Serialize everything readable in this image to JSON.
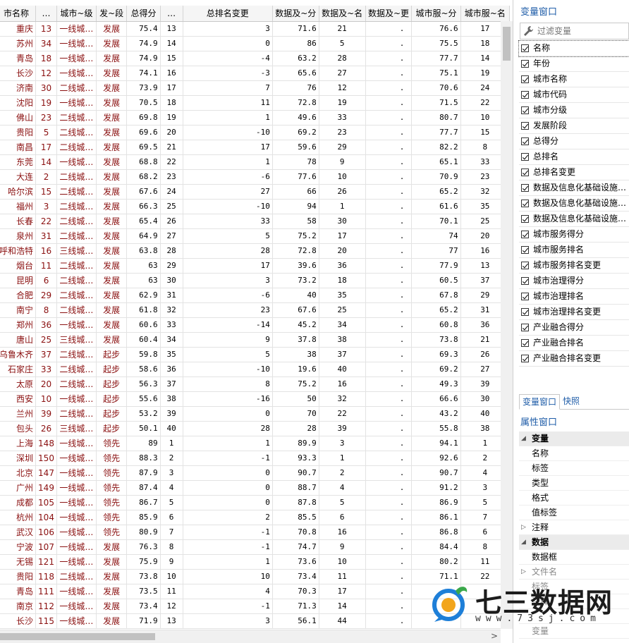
{
  "grid": {
    "columns": [
      "市名称",
      "…",
      "城市~级",
      "发~段",
      "总得分",
      "…",
      "总排名变更",
      "数据及~分",
      "数据及~名",
      "数据及~更",
      "城市服~分",
      "城市服~名"
    ],
    "rows": [
      [
        "重庆",
        "13",
        "一线城…",
        "发展",
        "75.4",
        "13",
        "3",
        "71.6",
        "21",
        ".",
        "76.6",
        "17"
      ],
      [
        "苏州",
        "34",
        "一线城…",
        "发展",
        "74.9",
        "14",
        "0",
        "86",
        "5",
        ".",
        "75.5",
        "18"
      ],
      [
        "青岛",
        "18",
        "一线城…",
        "发展",
        "74.9",
        "15",
        "-4",
        "63.2",
        "28",
        ".",
        "77.7",
        "14"
      ],
      [
        "长沙",
        "12",
        "一线城…",
        "发展",
        "74.1",
        "16",
        "-3",
        "65.6",
        "27",
        ".",
        "75.1",
        "19"
      ],
      [
        "济南",
        "30",
        "二线城…",
        "发展",
        "73.9",
        "17",
        "7",
        "76",
        "12",
        ".",
        "70.6",
        "24"
      ],
      [
        "沈阳",
        "19",
        "一线城…",
        "发展",
        "70.5",
        "18",
        "11",
        "72.8",
        "19",
        ".",
        "71.5",
        "22"
      ],
      [
        "佛山",
        "23",
        "二线城…",
        "发展",
        "69.8",
        "19",
        "1",
        "49.6",
        "33",
        ".",
        "80.7",
        "10"
      ],
      [
        "贵阳",
        "5",
        "二线城…",
        "发展",
        "69.6",
        "20",
        "-10",
        "69.2",
        "23",
        ".",
        "77.7",
        "15"
      ],
      [
        "南昌",
        "17",
        "二线城…",
        "发展",
        "69.5",
        "21",
        "17",
        "59.6",
        "29",
        ".",
        "82.2",
        "8"
      ],
      [
        "东莞",
        "14",
        "一线城…",
        "发展",
        "68.8",
        "22",
        "1",
        "78",
        "9",
        ".",
        "65.1",
        "33"
      ],
      [
        "大连",
        "2",
        "二线城…",
        "发展",
        "68.2",
        "23",
        "-6",
        "77.6",
        "10",
        ".",
        "70.9",
        "23"
      ],
      [
        "哈尔滨",
        "15",
        "二线城…",
        "发展",
        "67.6",
        "24",
        "27",
        "66",
        "26",
        ".",
        "65.2",
        "32"
      ],
      [
        "福州",
        "3",
        "二线城…",
        "发展",
        "66.3",
        "25",
        "-10",
        "94",
        "1",
        ".",
        "61.6",
        "35"
      ],
      [
        "长春",
        "22",
        "二线城…",
        "发展",
        "65.4",
        "26",
        "33",
        "58",
        "30",
        ".",
        "70.1",
        "25"
      ],
      [
        "泉州",
        "31",
        "二线城…",
        "发展",
        "64.9",
        "27",
        "5",
        "75.2",
        "17",
        ".",
        "74",
        "20"
      ],
      [
        "呼和浩特",
        "16",
        "三线城…",
        "发展",
        "63.8",
        "28",
        "28",
        "72.8",
        "20",
        ".",
        "77",
        "16"
      ],
      [
        "烟台",
        "11",
        "二线城…",
        "发展",
        "63",
        "29",
        "17",
        "39.6",
        "36",
        ".",
        "77.9",
        "13"
      ],
      [
        "昆明",
        "6",
        "二线城…",
        "发展",
        "63",
        "30",
        "3",
        "73.2",
        "18",
        ".",
        "60.5",
        "37"
      ],
      [
        "合肥",
        "29",
        "二线城…",
        "发展",
        "62.9",
        "31",
        "-6",
        "40",
        "35",
        ".",
        "67.8",
        "29"
      ],
      [
        "南宁",
        "8",
        "二线城…",
        "发展",
        "61.8",
        "32",
        "23",
        "67.6",
        "25",
        ".",
        "65.2",
        "31"
      ],
      [
        "郑州",
        "36",
        "一线城…",
        "发展",
        "60.6",
        "33",
        "-14",
        "45.2",
        "34",
        ".",
        "60.8",
        "36"
      ],
      [
        "唐山",
        "25",
        "三线城…",
        "发展",
        "60.4",
        "34",
        "9",
        "37.8",
        "38",
        ".",
        "73.8",
        "21"
      ],
      [
        "乌鲁木齐",
        "37",
        "二线城…",
        "起步",
        "59.8",
        "35",
        "5",
        "38",
        "37",
        ".",
        "69.3",
        "26"
      ],
      [
        "石家庄",
        "33",
        "二线城…",
        "起步",
        "58.6",
        "36",
        "-10",
        "19.6",
        "40",
        ".",
        "69.2",
        "27"
      ],
      [
        "太原",
        "20",
        "二线城…",
        "起步",
        "56.3",
        "37",
        "8",
        "75.2",
        "16",
        ".",
        "49.3",
        "39"
      ],
      [
        "西安",
        "10",
        "一线城…",
        "起步",
        "55.6",
        "38",
        "-16",
        "50",
        "32",
        ".",
        "66.6",
        "30"
      ],
      [
        "兰州",
        "39",
        "二线城…",
        "起步",
        "53.2",
        "39",
        "0",
        "70",
        "22",
        ".",
        "43.2",
        "40"
      ],
      [
        "包头",
        "26",
        "三线城…",
        "起步",
        "50.1",
        "40",
        "28",
        "28",
        "39",
        ".",
        "55.8",
        "38"
      ],
      [
        "上海",
        "148",
        "一线城…",
        "领先",
        "89",
        "1",
        "1",
        "89.9",
        "3",
        ".",
        "94.1",
        "1"
      ],
      [
        "深圳",
        "150",
        "一线城…",
        "领先",
        "88.3",
        "2",
        "-1",
        "93.3",
        "1",
        ".",
        "92.6",
        "2"
      ],
      [
        "北京",
        "147",
        "一线城…",
        "领先",
        "87.9",
        "3",
        "0",
        "90.7",
        "2",
        ".",
        "90.7",
        "4"
      ],
      [
        "广州",
        "149",
        "一线城…",
        "领先",
        "87.4",
        "4",
        "0",
        "88.7",
        "4",
        ".",
        "91.2",
        "3"
      ],
      [
        "成都",
        "105",
        "一线城…",
        "领先",
        "86.7",
        "5",
        "0",
        "87.8",
        "5",
        ".",
        "86.9",
        "5"
      ],
      [
        "杭州",
        "104",
        "一线城…",
        "领先",
        "85.9",
        "6",
        "2",
        "85.5",
        "6",
        ".",
        "86.1",
        "7"
      ],
      [
        "武汉",
        "106",
        "一线城…",
        "领先",
        "80.9",
        "7",
        "-1",
        "70.8",
        "16",
        ".",
        "86.8",
        "6"
      ],
      [
        "宁波",
        "107",
        "一线城…",
        "发展",
        "76.3",
        "8",
        "-1",
        "74.7",
        "9",
        ".",
        "84.4",
        "8"
      ],
      [
        "无锡",
        "121",
        "一线城…",
        "发展",
        "75.9",
        "9",
        "1",
        "73.6",
        "10",
        ".",
        "80.2",
        "11"
      ],
      [
        "贵阳",
        "118",
        "二线城…",
        "发展",
        "73.8",
        "10",
        "10",
        "73.4",
        "11",
        ".",
        "71.1",
        "22"
      ],
      [
        "青岛",
        "111",
        "一线城…",
        "发展",
        "73.5",
        "11",
        "4",
        "70.3",
        "17",
        ".",
        "",
        ""
      ],
      [
        "南京",
        "112",
        "一线城…",
        "发展",
        "73.4",
        "12",
        "-1",
        "71.3",
        "14",
        ".",
        "",
        ""
      ],
      [
        "长沙",
        "115",
        "一线城…",
        "发展",
        "71.9",
        "13",
        "3",
        "56.1",
        "44",
        ".",
        "",
        ""
      ]
    ]
  },
  "panel": {
    "var_title": "变量窗口",
    "filter_placeholder": "过滤变量",
    "variables": [
      "名称",
      "年份",
      "城市名称",
      "城市代码",
      "城市分级",
      "发展阶段",
      "总得分",
      "总排名",
      "总排名变更",
      "数据及信息化基础设施…",
      "数据及信息化基础设施…",
      "数据及信息化基础设施…",
      "城市服务得分",
      "城市服务排名",
      "城市服务排名变更",
      "城市治理得分",
      "城市治理排名",
      "城市治理排名变更",
      "产业融合得分",
      "产业融合排名",
      "产业融合排名变更"
    ],
    "tabs": [
      "变量窗口",
      "快照"
    ],
    "prop_title": "属性窗口",
    "props": [
      {
        "label": "变量",
        "kind": "group"
      },
      {
        "label": "名称",
        "kind": "child"
      },
      {
        "label": "标签",
        "kind": "child"
      },
      {
        "label": "类型",
        "kind": "child"
      },
      {
        "label": "格式",
        "kind": "child"
      },
      {
        "label": "值标签",
        "kind": "child"
      },
      {
        "label": "注释",
        "kind": "collapsed"
      },
      {
        "label": "数据",
        "kind": "group"
      },
      {
        "label": "数据框",
        "kind": "child"
      },
      {
        "label": "文件名",
        "kind": "muted"
      },
      {
        "label": "标签",
        "kind": "muted"
      },
      {
        "label": "注释",
        "kind": "muted"
      },
      {
        "label": "",
        "kind": "muted"
      },
      {
        "label": "变量",
        "kind": "muted"
      }
    ]
  },
  "watermark": {
    "text": "七三数据网",
    "url": "www.73sj.com"
  },
  "scroll": {
    "right_arrow": ">"
  }
}
